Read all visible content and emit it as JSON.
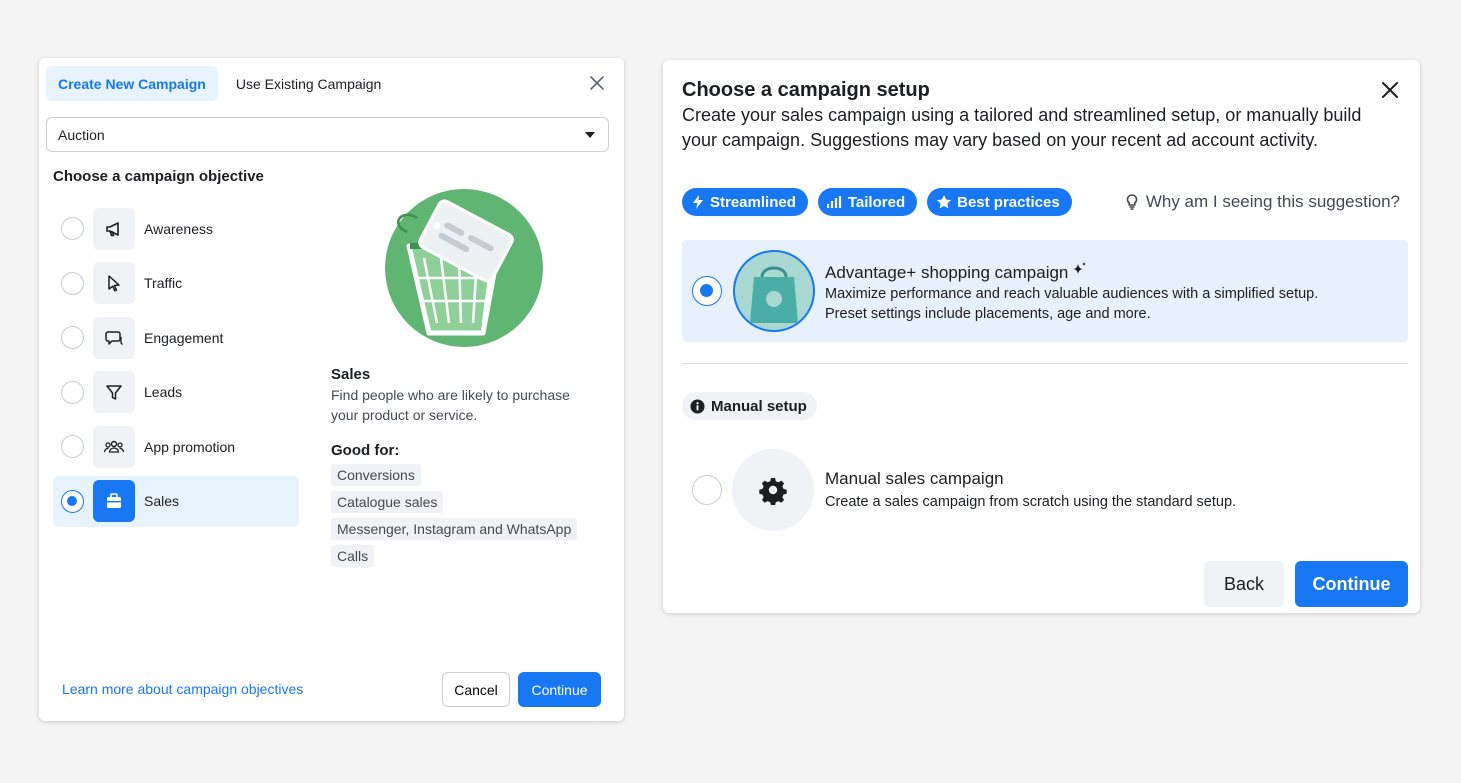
{
  "left_dialog": {
    "tabs": [
      {
        "label": "Create New Campaign",
        "active": true
      },
      {
        "label": "Use Existing Campaign",
        "active": false
      }
    ],
    "buying_type": "Auction",
    "objective_heading": "Choose a campaign objective",
    "objectives": [
      {
        "label": "Awareness",
        "icon": "megaphone-icon",
        "selected": false
      },
      {
        "label": "Traffic",
        "icon": "cursor-icon",
        "selected": false
      },
      {
        "label": "Engagement",
        "icon": "chat-bubble-icon",
        "selected": false
      },
      {
        "label": "Leads",
        "icon": "filter-icon",
        "selected": false
      },
      {
        "label": "App promotion",
        "icon": "people-icon",
        "selected": false
      },
      {
        "label": "Sales",
        "icon": "shopping-bag-icon",
        "selected": true
      }
    ],
    "detail": {
      "title": "Sales",
      "description": "Find people who are likely to purchase your product or service.",
      "good_for_heading": "Good for:",
      "good_for": [
        "Conversions",
        "Catalogue sales",
        "Messenger, Instagram and WhatsApp",
        "Calls"
      ]
    },
    "learn_more": "Learn more about campaign objectives",
    "cancel_label": "Cancel",
    "continue_label": "Continue"
  },
  "right_dialog": {
    "title": "Choose a campaign setup",
    "description": "Create your sales campaign using a tailored and streamlined setup, or manually build your campaign. Suggestions may vary based on your recent ad account activity.",
    "pills": [
      {
        "label": "Streamlined",
        "icon": "lightning-icon"
      },
      {
        "label": "Tailored",
        "icon": "bar-chart-icon"
      },
      {
        "label": "Best practices",
        "icon": "star-icon"
      }
    ],
    "why_link": "Why am I seeing this suggestion?",
    "advantage": {
      "title": "Advantage+ shopping campaign",
      "line1": "Maximize performance and reach valuable audiences with a simplified setup.",
      "line2": "Preset settings include placements, age and more.",
      "selected": true
    },
    "manual_badge": "Manual setup",
    "manual": {
      "title": "Manual sales campaign",
      "description": "Create a sales campaign from scratch using the standard setup.",
      "selected": false
    },
    "back_label": "Back",
    "continue_label": "Continue"
  },
  "colors": {
    "accent": "#1877f2",
    "selected_bg": "#e7f3ff",
    "illustration_green": "#5fb46e"
  }
}
